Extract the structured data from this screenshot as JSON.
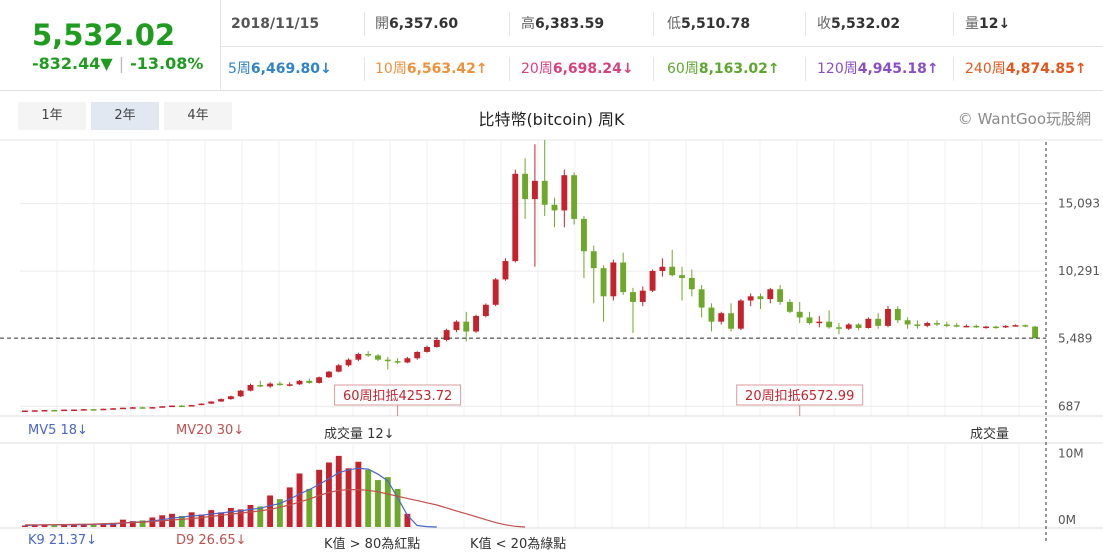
{
  "header": {
    "price": "5,532.02",
    "change": "-832.44",
    "change_arrow": "▼",
    "change_pct": "-13.08%",
    "date": "2018/11/15",
    "open_label": "開",
    "open": "6,357.60",
    "high_label": "高",
    "high": "6,383.59",
    "low_label": "低",
    "low": "5,510.78",
    "close_label": "收",
    "close": "5,532.02",
    "vol_label": "量",
    "vol": "12↓",
    "ma": [
      {
        "label": "5周",
        "value": "6,469.80↓",
        "color": "#2f83c6"
      },
      {
        "label": "10周",
        "value": "6,563.42↑",
        "color": "#f0913a"
      },
      {
        "label": "20周",
        "value": "6,698.24↓",
        "color": "#d9417a"
      },
      {
        "label": "60周",
        "value": "8,163.02↑",
        "color": "#5ea72e"
      },
      {
        "label": "120周",
        "value": "4,945.18↑",
        "color": "#8a4fc4"
      },
      {
        "label": "240周",
        "value": "4,874.85↑",
        "color": "#e3561c"
      }
    ]
  },
  "tabs": [
    "1年",
    "2年",
    "4年"
  ],
  "active_tab": 1,
  "title": "比特幣(bitcoin) 周K",
  "credit": "© WantGoo玩股網",
  "legend_top": {
    "mv5": "MV5 18↓",
    "mv20": "MV20 30↓",
    "volume": "成交量 12↓",
    "volume_right": "成交量"
  },
  "legend_bottom": {
    "k9": "K9 21.37↓",
    "d9": "D9 26.65↓",
    "k_gt": "K值 > 80為紅點",
    "k_lt": "K值 < 20為綠點"
  },
  "colors": {
    "up": "#c4232e",
    "down": "#6ea82a",
    "mv5": "#4a67c9",
    "mv20": "#c0504d"
  },
  "chart_data": {
    "type": "candlestick",
    "y_ticks": [
      687,
      5489,
      10291,
      15093
    ],
    "ylim": [
      0,
      19600
    ],
    "current_price_line": 5532,
    "annotations": [
      {
        "text": "60周扣抵4253.72",
        "index": 38
      },
      {
        "text": "20周扣抵6572.99",
        "index": 79
      }
    ],
    "candles": [
      [
        390,
        395,
        380,
        390
      ],
      [
        390,
        410,
        385,
        405
      ],
      [
        405,
        430,
        400,
        425
      ],
      [
        425,
        440,
        415,
        420
      ],
      [
        420,
        460,
        418,
        455
      ],
      [
        455,
        470,
        440,
        460
      ],
      [
        460,
        490,
        455,
        485
      ],
      [
        485,
        500,
        470,
        480
      ],
      [
        480,
        520,
        475,
        515
      ],
      [
        515,
        560,
        505,
        550
      ],
      [
        550,
        600,
        540,
        590
      ],
      [
        590,
        640,
        575,
        620
      ],
      [
        620,
        660,
        600,
        615
      ],
      [
        615,
        640,
        595,
        630
      ],
      [
        630,
        700,
        620,
        690
      ],
      [
        690,
        760,
        680,
        740
      ],
      [
        740,
        780,
        700,
        720
      ],
      [
        720,
        790,
        710,
        780
      ],
      [
        780,
        900,
        770,
        880
      ],
      [
        880,
        1050,
        860,
        1030
      ],
      [
        1030,
        1250,
        1000,
        1200
      ],
      [
        1200,
        1450,
        1150,
        1400
      ],
      [
        1400,
        1850,
        1350,
        1800
      ],
      [
        1800,
        2300,
        1750,
        2200
      ],
      [
        2200,
        2500,
        2050,
        2100
      ],
      [
        2100,
        2400,
        2000,
        2300
      ],
      [
        2300,
        2450,
        2150,
        2200
      ],
      [
        2200,
        2400,
        2100,
        2250
      ],
      [
        2250,
        2550,
        2200,
        2500
      ],
      [
        2500,
        2650,
        2300,
        2350
      ],
      [
        2350,
        2800,
        2300,
        2750
      ],
      [
        2750,
        3200,
        2700,
        3150
      ],
      [
        3150,
        3700,
        3100,
        3600
      ],
      [
        3600,
        4100,
        3500,
        4000
      ],
      [
        4000,
        4500,
        3900,
        4400
      ],
      [
        4400,
        4600,
        4200,
        4300
      ],
      [
        4300,
        4400,
        3900,
        4000
      ],
      [
        4000,
        4200,
        3300,
        3900
      ],
      [
        3900,
        4100,
        3700,
        3800
      ],
      [
        3800,
        4200,
        3750,
        4100
      ],
      [
        4100,
        4600,
        4000,
        4550
      ],
      [
        4550,
        5000,
        4500,
        4900
      ],
      [
        4900,
        5500,
        4850,
        5400
      ],
      [
        5400,
        6200,
        5300,
        6100
      ],
      [
        6100,
        6800,
        5950,
        6700
      ],
      [
        6700,
        7400,
        5300,
        6000
      ],
      [
        6000,
        7200,
        5900,
        7100
      ],
      [
        7100,
        8000,
        7000,
        7900
      ],
      [
        7900,
        9800,
        7800,
        9700
      ],
      [
        9700,
        11200,
        9600,
        11000
      ],
      [
        11000,
        17500,
        10900,
        17200
      ],
      [
        17200,
        18300,
        14000,
        15400
      ],
      [
        15400,
        19300,
        10600,
        16700
      ],
      [
        16700,
        19600,
        14200,
        15000
      ],
      [
        15000,
        15500,
        13400,
        14600
      ],
      [
        14600,
        17500,
        13400,
        17100
      ],
      [
        17100,
        17300,
        13600,
        14000
      ],
      [
        14000,
        14200,
        9800,
        11700
      ],
      [
        11700,
        12100,
        8000,
        10500
      ],
      [
        10500,
        10700,
        6700,
        8500
      ],
      [
        8500,
        11100,
        8200,
        10900
      ],
      [
        10900,
        11600,
        8600,
        8800
      ],
      [
        8800,
        9100,
        5900,
        8100
      ],
      [
        8100,
        9200,
        7800,
        8900
      ],
      [
        8900,
        10400,
        8800,
        10300
      ],
      [
        10300,
        11200,
        9900,
        10600
      ],
      [
        10600,
        11800,
        9900,
        10000
      ],
      [
        10000,
        10600,
        8200,
        9800
      ],
      [
        9800,
        10400,
        8500,
        9000
      ],
      [
        9000,
        9300,
        7000,
        7700
      ],
      [
        7700,
        8000,
        6000,
        6700
      ],
      [
        6700,
        7400,
        6500,
        7300
      ],
      [
        7300,
        8000,
        6000,
        6200
      ],
      [
        6200,
        8300,
        6100,
        8200
      ],
      [
        8200,
        8700,
        7800,
        8500
      ],
      [
        8500,
        8700,
        7600,
        8300
      ],
      [
        8300,
        9100,
        8000,
        9000
      ],
      [
        9000,
        9300,
        7900,
        8100
      ],
      [
        8100,
        8300,
        7300,
        7400
      ],
      [
        7400,
        8100,
        6600,
        7000
      ],
      [
        7000,
        7400,
        6500,
        6600
      ],
      [
        6600,
        7100,
        6300,
        6700
      ],
      [
        6700,
        7500,
        6200,
        6300
      ],
      [
        6300,
        6600,
        5800,
        6200
      ],
      [
        6200,
        6600,
        6100,
        6500
      ],
      [
        6500,
        6600,
        6100,
        6250
      ],
      [
        6250,
        7000,
        6200,
        6900
      ],
      [
        6900,
        7300,
        6200,
        6400
      ],
      [
        6400,
        7800,
        6300,
        7600
      ],
      [
        7600,
        7800,
        6600,
        6800
      ],
      [
        6800,
        7000,
        6200,
        6500
      ],
      [
        6500,
        6800,
        6200,
        6400
      ],
      [
        6400,
        6700,
        6300,
        6600
      ],
      [
        6600,
        6800,
        6400,
        6500
      ],
      [
        6500,
        6700,
        6300,
        6450
      ],
      [
        6450,
        6600,
        6300,
        6350
      ],
      [
        6350,
        6500,
        6300,
        6400
      ],
      [
        6400,
        6500,
        6250,
        6300
      ],
      [
        6300,
        6400,
        6200,
        6350
      ],
      [
        6350,
        6400,
        6200,
        6300
      ],
      [
        6300,
        6450,
        6250,
        6400
      ],
      [
        6400,
        6500,
        6350,
        6450
      ],
      [
        6450,
        6500,
        6300,
        6350
      ],
      [
        6350,
        6400,
        5510,
        5532
      ]
    ],
    "volume": [
      0.2,
      0.2,
      0.3,
      0.2,
      0.4,
      0.3,
      0.3,
      0.4,
      0.5,
      0.4,
      1.0,
      0.8,
      0.9,
      1.3,
      1.6,
      1.8,
      1.5,
      2.0,
      1.7,
      2.3,
      2.0,
      2.6,
      2.4,
      3.0,
      2.8,
      4.3,
      3.8,
      5.4,
      7.3,
      5.2,
      7.8,
      8.8,
      9.7,
      8.0,
      8.9,
      7.8,
      6.4,
      6.8,
      5.2,
      1.8
    ],
    "mv5": [
      0.2,
      0.25,
      0.3,
      0.3,
      0.3,
      0.3,
      0.32,
      0.35,
      0.4,
      0.4,
      0.55,
      0.65,
      0.7,
      0.85,
      1.0,
      1.2,
      1.35,
      1.5,
      1.6,
      1.8,
      1.9,
      2.1,
      2.2,
      2.4,
      2.55,
      2.9,
      3.2,
      3.8,
      4.5,
      5.1,
      5.8,
      6.6,
      7.4,
      7.8,
      8.0,
      7.9,
      7.2,
      6.3,
      4.0,
      1.6,
      0.2,
      0.05,
      0.0
    ],
    "mv20": [
      0.3,
      0.3,
      0.3,
      0.32,
      0.33,
      0.35,
      0.38,
      0.4,
      0.45,
      0.5,
      0.55,
      0.6,
      0.65,
      0.75,
      0.85,
      0.95,
      1.05,
      1.15,
      1.3,
      1.45,
      1.6,
      1.75,
      1.9,
      2.05,
      2.2,
      2.4,
      2.7,
      3.0,
      3.4,
      3.8,
      4.3,
      4.7,
      5.0,
      5.1,
      5.1,
      5.0,
      4.8,
      4.5,
      4.2,
      3.9,
      3.6,
      3.3,
      3.0,
      2.6,
      2.2,
      1.8,
      1.4,
      1.0,
      0.6,
      0.3,
      0.1,
      0.0
    ]
  }
}
